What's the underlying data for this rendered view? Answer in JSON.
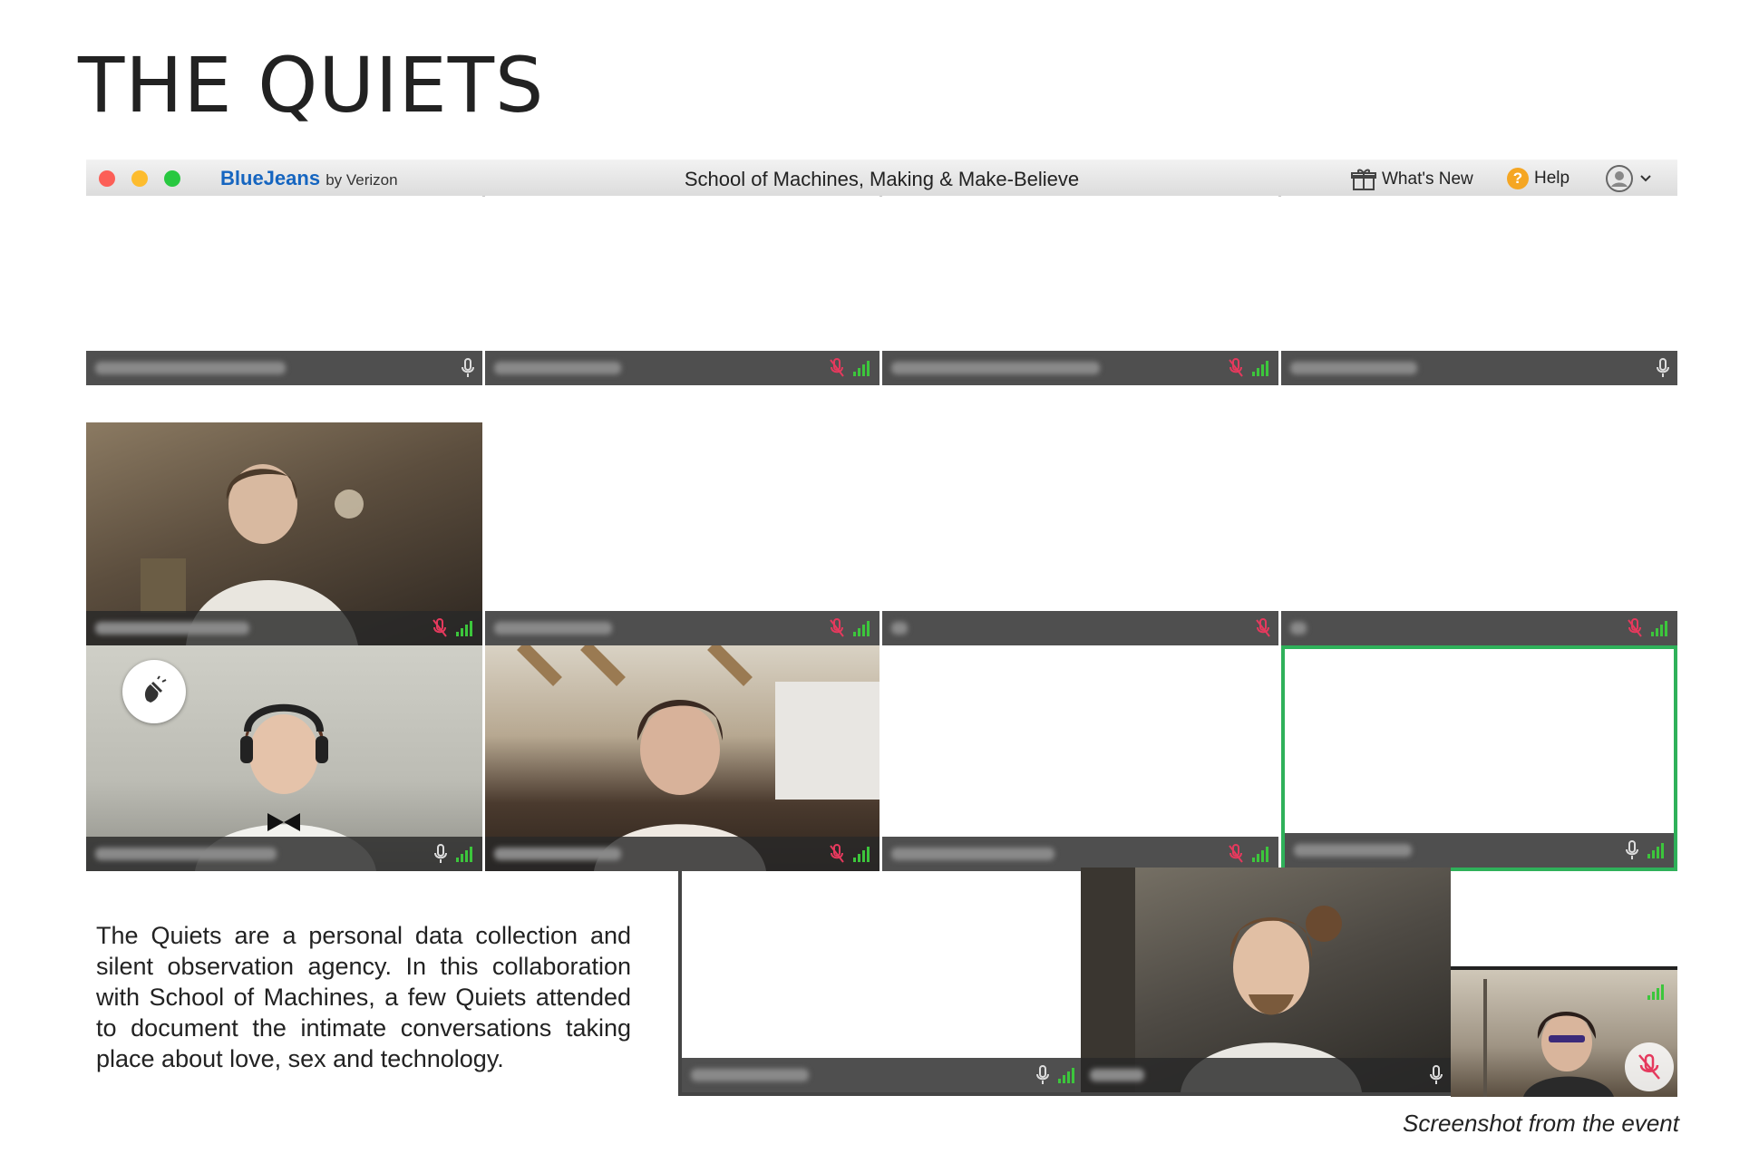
{
  "page": {
    "title": "THE QUIETS"
  },
  "window": {
    "brand": "BlueJeans",
    "brand_sub": "by Verizon",
    "title": "School of Machines, Making & Make-Believe",
    "whats_new": "What's New",
    "help": "Help",
    "help_glyph": "?"
  },
  "colors": {
    "accent": "#1565c0",
    "mute": "#e5395d",
    "signal": "#3cc63c",
    "hangup": "#ee3353",
    "active_speaker": "#2fb15a"
  },
  "controls": [
    "video-camera-icon",
    "mic-muted-icon",
    "screen-share-icon",
    "hang-up-icon"
  ],
  "caption": "The Quiets are a personal data collection and silent observation agency. In this collaboration with School of Machines, a few Quiets attended to document the intimate conversations taking place about love, sex and technology.",
  "credit": "Screenshot from the event"
}
